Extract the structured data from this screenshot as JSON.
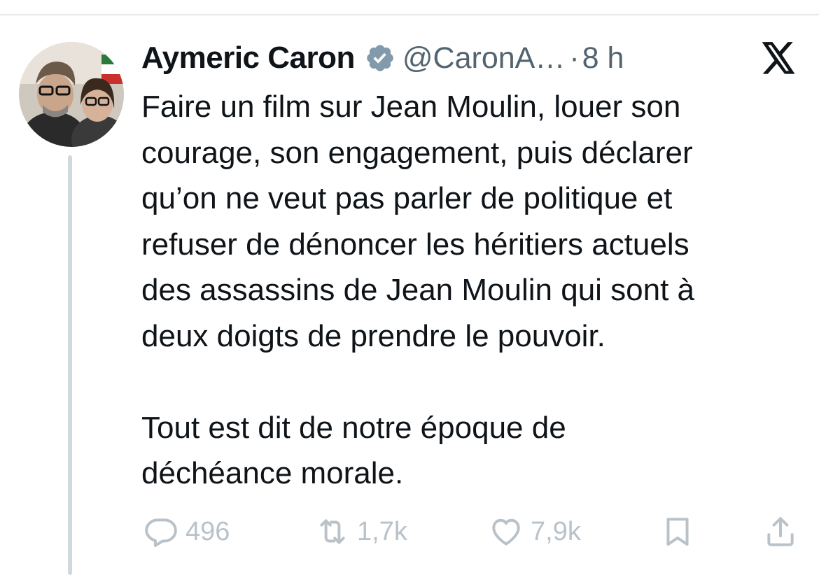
{
  "author": {
    "display_name": "Aymeric Caron",
    "handle": "@CaronA…",
    "separator": "·",
    "time": "8 h",
    "verified_color": "#829aab"
  },
  "tweet": {
    "text": "Faire un film sur Jean Moulin, louer son\ncourage, son engagement, puis déclarer\nqu’on ne veut pas parler de politique et\nrefuser de dénoncer les héritiers actuels\ndes assassins de Jean Moulin qui sont à\ndeux doigts de prendre le pouvoir.\n\nTout est dit de notre époque de\ndéchéance morale."
  },
  "actions": {
    "replies": "496",
    "reposts": "1,7k",
    "likes": "7,9k",
    "icons": [
      "reply-icon",
      "repost-icon",
      "like-icon",
      "bookmark-icon",
      "share-icon"
    ]
  },
  "colors": {
    "text": "#0f1419",
    "secondary": "#536471",
    "faded_action": "#b9c2c9",
    "thread_line": "#cfd9de"
  }
}
